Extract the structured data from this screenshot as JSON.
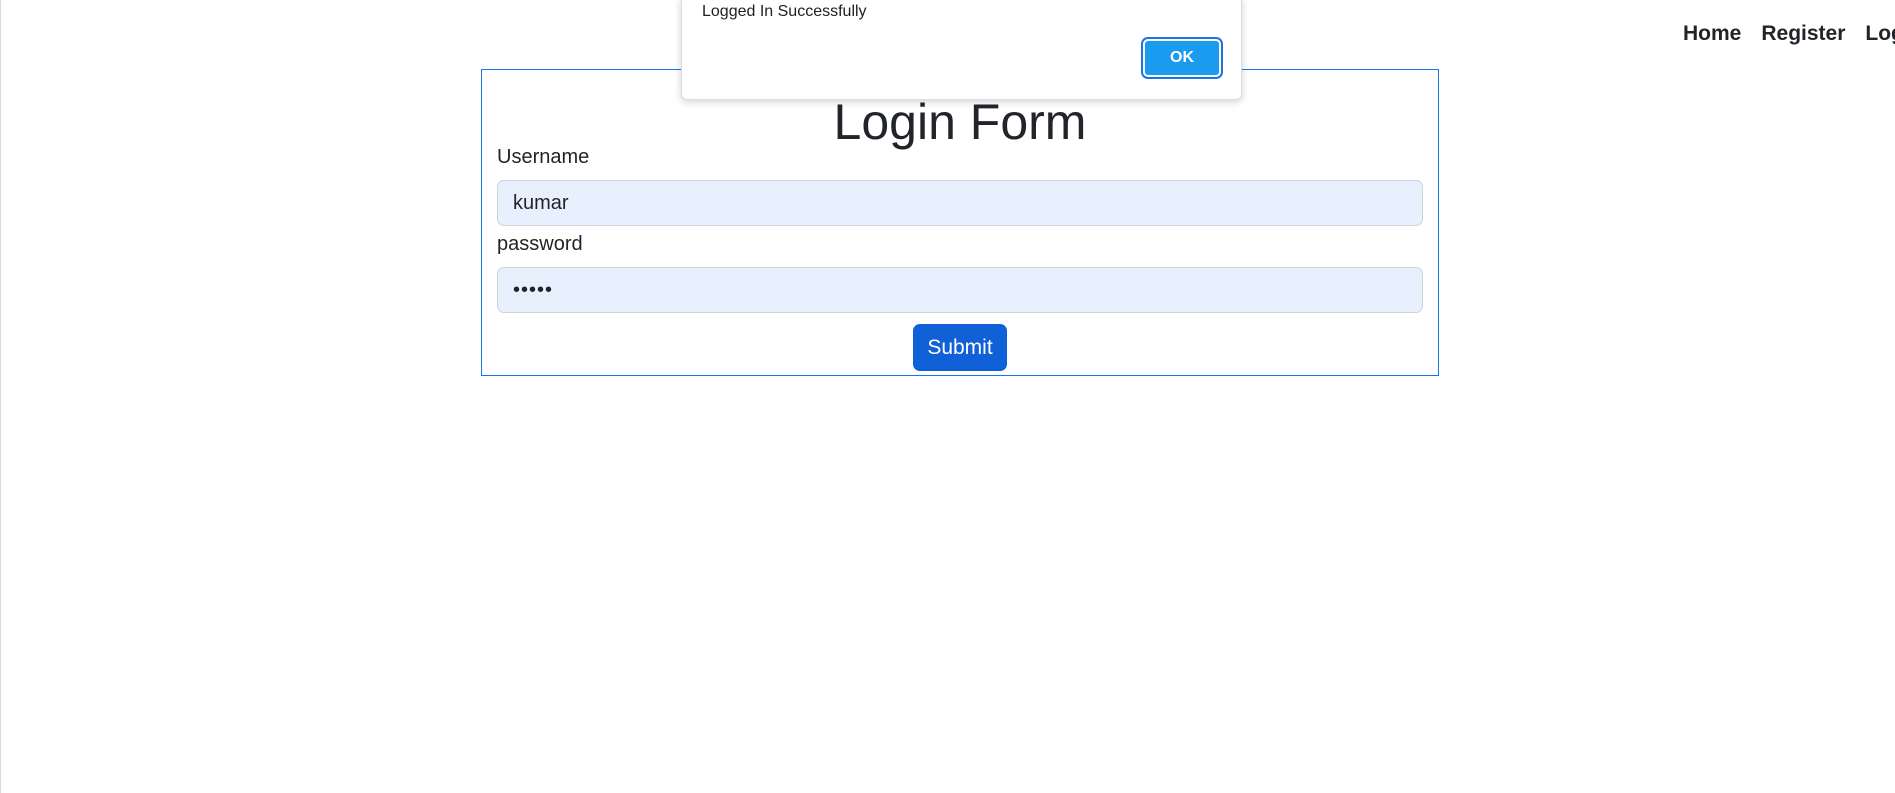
{
  "nav": {
    "links": [
      "Home",
      "Register",
      "Logi"
    ]
  },
  "login_form": {
    "title": "Login Form",
    "username_label": "Username",
    "username_value": "kumar",
    "password_label": "password",
    "password_value": "•••••",
    "submit_label": "Submit"
  },
  "alert": {
    "message": "Logged In Successfully",
    "ok_label": "OK"
  },
  "colors": {
    "accent": "#1a73e8",
    "submit_button": "#1060d8",
    "input_background": "#e8f0fe"
  }
}
